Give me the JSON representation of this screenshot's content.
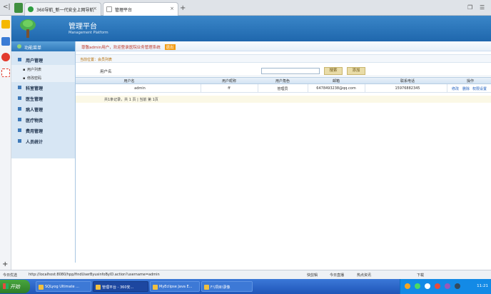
{
  "browser": {
    "tabs": [
      {
        "label": "360导航_新一代安全上网导航"
      },
      {
        "label": "管理平台"
      }
    ],
    "new_tab": "+",
    "back": "<|"
  },
  "app": {
    "title": "管理平台",
    "subtitle": "Management Platform"
  },
  "menu": {
    "header": "功能菜单",
    "items": [
      {
        "label": "用户管理"
      },
      {
        "label": "科室管理"
      },
      {
        "label": "医生管理"
      },
      {
        "label": "病人管理"
      },
      {
        "label": "医疗物资"
      },
      {
        "label": "费用管理"
      },
      {
        "label": "人员统计"
      }
    ],
    "subitems": [
      {
        "label": "用户列表"
      },
      {
        "label": "修改密码"
      }
    ]
  },
  "welcome": {
    "text": "尊敬admin用户，欢迎登录医院业务管理系统",
    "logout": "退出"
  },
  "breadcrumb": "当前位置：会员列表",
  "search": {
    "label": "用户名",
    "value": "",
    "search_button": "搜索",
    "add_button": "添加"
  },
  "table": {
    "headers": [
      "用户名",
      "用户昵称",
      "用户角色",
      "邮箱",
      "联系电话",
      "操作"
    ],
    "rows": [
      {
        "username": "admin",
        "nickname": "ff",
        "role": "管理员",
        "email": "6478493238@qq.com",
        "phone": "15976882345",
        "actions": [
          "修改",
          "删除",
          "权限设置"
        ]
      }
    ]
  },
  "pager": "共1条记录，共 1 页 | 当前 第 1页",
  "statusbar": {
    "left": "今日优选",
    "url": "http://localhost:8080/hpp/findUserByusinfoByID.action?username=admin",
    "right_items": [
      "快剪辑",
      "今日直播",
      "热点资讯",
      "下载"
    ]
  },
  "taskbar": {
    "start": "开始",
    "tasks": [
      {
        "label": "SQLyog Ultimate ..."
      },
      {
        "label": "管理平台 - 360安..."
      },
      {
        "label": "MyEclipse Java E..."
      },
      {
        "label": "F:\\项目\\录像"
      }
    ],
    "clock": "11:21"
  }
}
